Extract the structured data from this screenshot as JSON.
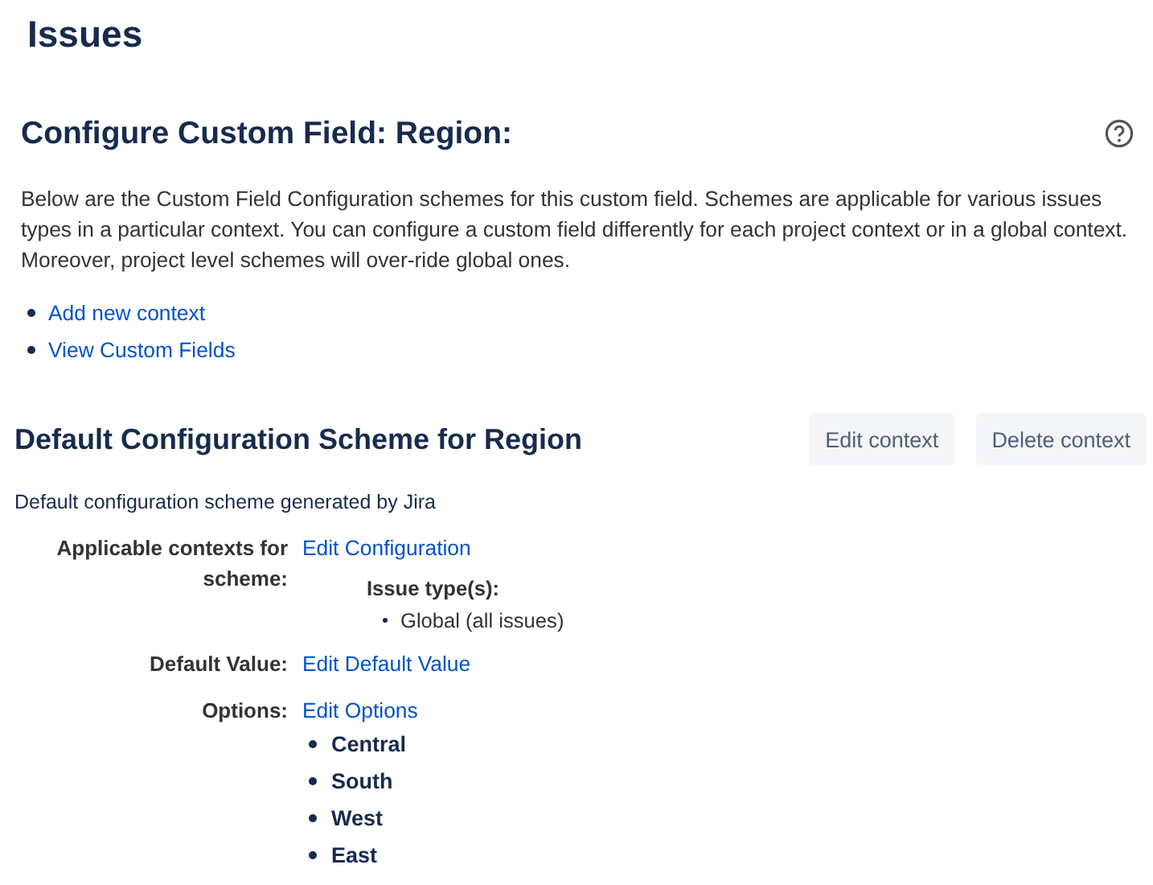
{
  "page_title": "Issues",
  "header": {
    "title": "Configure Custom Field: Region:"
  },
  "description": "Below are the Custom Field Configuration schemes for this custom field. Schemes are applicable for various issues types in a particular context. You can configure a custom field differently for each project context or in a global context. Moreover, project level schemes will over-ride global ones.",
  "links": [
    "Add new context",
    "View Custom Fields"
  ],
  "scheme": {
    "title": "Default Configuration Scheme for Region",
    "buttons": [
      "Edit context",
      "Delete context"
    ],
    "description": "Default configuration scheme generated by Jira",
    "fields": [
      {
        "kind": "contexts",
        "label": "Applicable contexts for scheme:",
        "link": "Edit Configuration",
        "subheading": "Issue type(s):",
        "items": [
          "Global (all issues)"
        ]
      },
      {
        "kind": "plain",
        "label": "Default Value:",
        "link": "Edit Default Value"
      },
      {
        "kind": "options",
        "label": "Options:",
        "link": "Edit Options",
        "items": [
          "Central",
          "South",
          "West",
          "East"
        ]
      }
    ]
  }
}
